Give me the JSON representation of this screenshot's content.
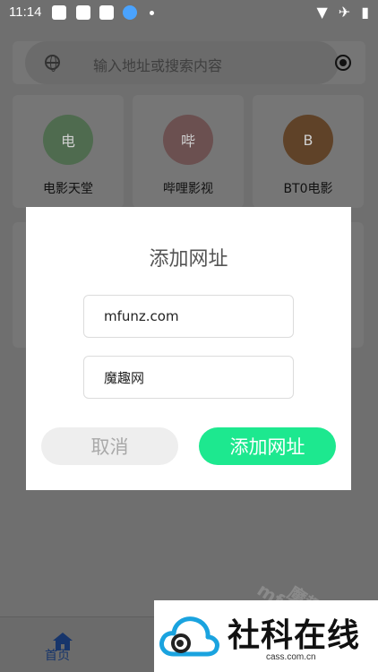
{
  "statusbar": {
    "time": "11:14"
  },
  "search": {
    "placeholder": "输入地址或搜索内容"
  },
  "sites": [
    {
      "initial": "电",
      "label": "电影天堂",
      "color": "#4f6b4f"
    },
    {
      "initial": "哔",
      "label": "哔哩影视",
      "color": "#6b5050"
    },
    {
      "initial": "B",
      "label": "BT0电影",
      "color": "#5f4228"
    }
  ],
  "dialog": {
    "title": "添加网址",
    "url_value": "mfunz.com",
    "name_value": "魔趣网",
    "cancel_label": "取消",
    "add_label": "添加网址"
  },
  "nav": {
    "home_label": "首页"
  },
  "watermark": {
    "left": "mf",
    "right": "魔趣"
  },
  "brand": {
    "name": "社科在线",
    "domain": "cass.com.cn"
  },
  "colors": {
    "accent": "#1de88f",
    "nav_active": "#17356b"
  }
}
